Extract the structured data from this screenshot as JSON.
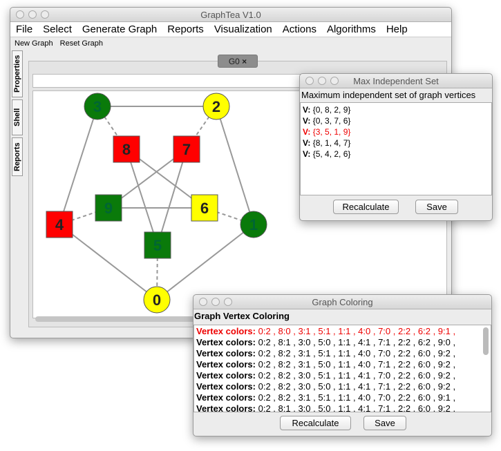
{
  "main": {
    "title": "GraphTea V1.0",
    "menu": [
      "File",
      "Select",
      "Generate Graph",
      "Reports",
      "Visualization",
      "Actions",
      "Algorithms",
      "Help"
    ],
    "toolbar": [
      "New Graph",
      "Reset Graph"
    ],
    "side_tabs": [
      "Properties",
      "Shell",
      "Reports"
    ],
    "tab": "G0",
    "tab_close": "×"
  },
  "graph": {
    "colors": {
      "green": "#0a7a0a",
      "yellow": "#ffff00",
      "red": "#ff0000"
    },
    "nodes": [
      {
        "label": "0",
        "shape": "circle",
        "color": "yellow"
      },
      {
        "label": "1",
        "shape": "circle",
        "color": "green"
      },
      {
        "label": "2",
        "shape": "circle",
        "color": "yellow"
      },
      {
        "label": "3",
        "shape": "circle",
        "color": "green"
      },
      {
        "label": "4",
        "shape": "square",
        "color": "red"
      },
      {
        "label": "5",
        "shape": "square",
        "color": "green"
      },
      {
        "label": "6",
        "shape": "square",
        "color": "yellow"
      },
      {
        "label": "7",
        "shape": "square",
        "color": "red"
      },
      {
        "label": "8",
        "shape": "square",
        "color": "red"
      },
      {
        "label": "9",
        "shape": "square",
        "color": "green"
      }
    ],
    "edges": [
      [
        3,
        2,
        "solid"
      ],
      [
        3,
        8,
        "dashed"
      ],
      [
        2,
        7,
        "dashed"
      ],
      [
        3,
        4,
        "solid"
      ],
      [
        2,
        1,
        "solid"
      ],
      [
        4,
        9,
        "dashed"
      ],
      [
        6,
        1,
        "dashed"
      ],
      [
        4,
        0,
        "solid"
      ],
      [
        1,
        0,
        "solid"
      ],
      [
        5,
        0,
        "dashed"
      ],
      [
        8,
        5,
        "solid"
      ],
      [
        8,
        6,
        "solid"
      ],
      [
        7,
        9,
        "solid"
      ],
      [
        7,
        5,
        "solid"
      ],
      [
        9,
        6,
        "solid"
      ]
    ]
  },
  "mis": {
    "title": "Max Independent Set",
    "header": "Maximum independent set of graph vertices",
    "prefix": "V:",
    "rows": [
      {
        "text": "{0, 8, 2, 9}",
        "hl": false
      },
      {
        "text": "{0, 3, 7, 6}",
        "hl": false
      },
      {
        "text": "{3, 5, 1, 9}",
        "hl": true
      },
      {
        "text": "{8, 1, 4, 7}",
        "hl": false
      },
      {
        "text": "{5, 4, 2, 6}",
        "hl": false
      }
    ],
    "recalc": "Recalculate",
    "save": "Save"
  },
  "coloring": {
    "title": "Graph Coloring",
    "header": "Graph Vertex Coloring",
    "prefix": "Vertex colors:",
    "rows": [
      {
        "text": "0:2 , 8:0 , 3:1 , 5:1 , 1:1 , 4:0 , 7:0 , 2:2 , 6:2 , 9:1 ,",
        "hl": true
      },
      {
        "text": "0:2 , 8:1 , 3:0 , 5:0 , 1:1 , 4:1 , 7:1 , 2:2 , 6:2 , 9:0 ,",
        "hl": false
      },
      {
        "text": "0:2 , 8:2 , 3:1 , 5:1 , 1:1 , 4:0 , 7:0 , 2:2 , 6:0 , 9:2 ,",
        "hl": false
      },
      {
        "text": "0:2 , 8:2 , 3:1 , 5:0 , 1:1 , 4:0 , 7:1 , 2:2 , 6:0 , 9:2 ,",
        "hl": false
      },
      {
        "text": "0:2 , 8:2 , 3:0 , 5:1 , 1:1 , 4:1 , 7:0 , 2:2 , 6:0 , 9:2 ,",
        "hl": false
      },
      {
        "text": "0:2 , 8:2 , 3:0 , 5:0 , 1:1 , 4:1 , 7:1 , 2:2 , 6:0 , 9:2 ,",
        "hl": false
      },
      {
        "text": "0:2 , 8:2 , 3:1 , 5:1 , 1:1 , 4:0 , 7:0 , 2:2 , 6:0 , 9:1 ,",
        "hl": false
      },
      {
        "text": "0:2 , 8:1 , 3:0 , 5:0 , 1:1 , 4:1 , 7:1 , 2:2 , 6:0 , 9:2 ,",
        "hl": false
      }
    ],
    "recalc": "Recalculate",
    "save": "Save"
  }
}
